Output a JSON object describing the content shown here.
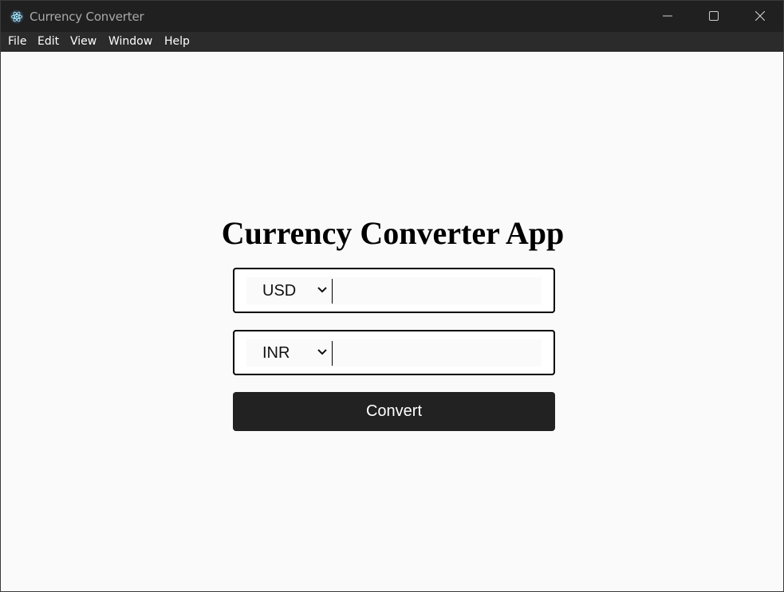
{
  "window": {
    "title": "Currency Converter",
    "icon": "electron-app-icon"
  },
  "menu": [
    "File",
    "Edit",
    "View",
    "Window",
    "Help"
  ],
  "main": {
    "heading": "Currency Converter App",
    "from": {
      "currency": "USD",
      "amount": ""
    },
    "to": {
      "currency": "INR",
      "amount": ""
    },
    "convert_label": "Convert"
  },
  "colors": {
    "titlebar": "#202020",
    "menubar": "#2b2b2b",
    "content_bg": "#fafafa",
    "button_bg": "#222222"
  }
}
